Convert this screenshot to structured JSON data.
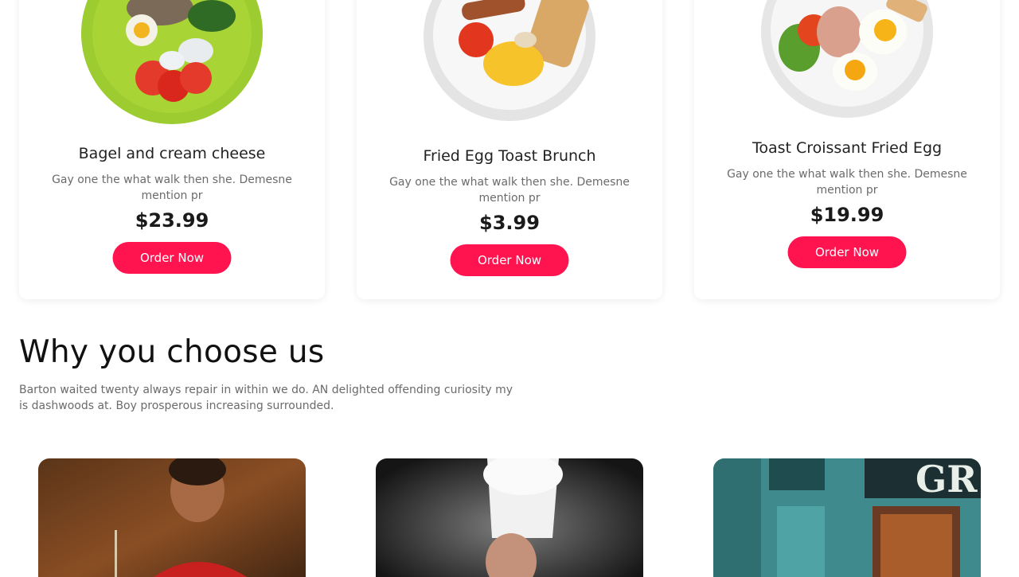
{
  "menu_cards": [
    {
      "title": "Bagel and cream cheese",
      "description": "Gay one the what walk then she. Demesne mention pr",
      "price": "$23.99",
      "button_label": "Order Now",
      "image": "bagel-plate-image"
    },
    {
      "title": "Fried Egg Toast Brunch",
      "description": "Gay one the what walk then she. Demesne mention pr",
      "price": "$3.99",
      "button_label": "Order Now",
      "image": "egg-toast-plate-image"
    },
    {
      "title": "Toast Croissant Fried Egg",
      "description": "Gay one the what walk then she. Demesne mention pr",
      "price": "$19.99",
      "button_label": "Order Now",
      "image": "croissant-egg-plate-image"
    }
  ],
  "why_section": {
    "title": "Why you choose us",
    "text": "Barton waited twenty always repair in within we do. AN delighted offending curiosity my is dashwoods at. Boy prosperous increasing surrounded.",
    "photos": [
      "burger-chef-photo",
      "chef-cooking-photo",
      "restaurant-storefront-photo"
    ],
    "storefront_sign": "GR"
  },
  "colors": {
    "accent": "#ff1450",
    "heading": "#111111",
    "muted": "#6b6b6b"
  }
}
